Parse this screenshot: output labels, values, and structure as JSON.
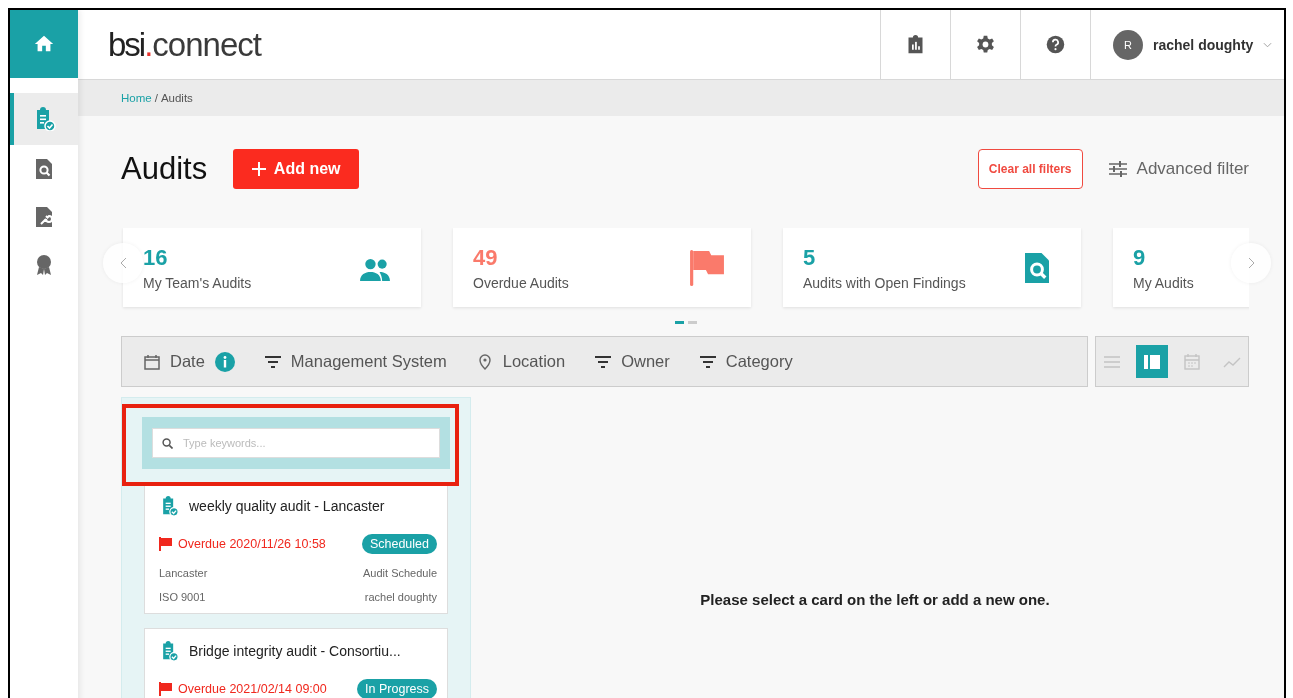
{
  "sidebar": {
    "items": [
      {
        "kind": "audits",
        "selected": true
      },
      {
        "kind": "findings",
        "selected": false
      },
      {
        "kind": "actions",
        "selected": false
      },
      {
        "kind": "certificates",
        "selected": false
      }
    ]
  },
  "header": {
    "logo": {
      "brand": "bsi",
      "dot": ".",
      "product": "connect"
    },
    "user": {
      "initial": "R",
      "name": "rachel doughty"
    }
  },
  "breadcrumb": {
    "link": "Home",
    "separator": "/",
    "current": "Audits"
  },
  "page": {
    "title": "Audits",
    "add_button": "Add new",
    "clear_filters": "Clear all filters",
    "advanced_filter": "Advanced filter"
  },
  "stats": [
    {
      "kind": "team",
      "value": "16",
      "label": "My Team's Audits",
      "color": "#1aa1a6"
    },
    {
      "kind": "overdue",
      "value": "49",
      "label": "Overdue Audits",
      "color": "#fa7a6b"
    },
    {
      "kind": "findings",
      "value": "5",
      "label": "Audits with Open Findings",
      "color": "#1aa1a6"
    },
    {
      "kind": "mine",
      "value": "9",
      "label": "My Audits",
      "color": "#1aa1a6"
    }
  ],
  "carousel_pages": [
    {
      "selected": true
    },
    {
      "selected": false
    }
  ],
  "filters": [
    {
      "kind": "date",
      "label": "Date"
    },
    {
      "kind": "filter",
      "label": "Management System"
    },
    {
      "kind": "location",
      "label": "Location"
    },
    {
      "kind": "filter",
      "label": "Owner"
    },
    {
      "kind": "filter",
      "label": "Category"
    }
  ],
  "views": [
    {
      "kind": "list",
      "selected": false
    },
    {
      "kind": "board",
      "selected": true
    },
    {
      "kind": "calendar",
      "selected": false
    },
    {
      "kind": "chart",
      "selected": false
    }
  ],
  "search": {
    "placeholder": "Type keywords..."
  },
  "highlight_search": true,
  "audits": [
    {
      "title": "weekly quality audit - Lancaster",
      "due": "Overdue 2020/11/26 10:58",
      "overdue": true,
      "status": "Scheduled",
      "location": "Lancaster",
      "type": "Audit Schedule",
      "standard": "ISO 9001",
      "owner": "rachel doughty"
    },
    {
      "title": "Bridge integrity audit - Consortiu...",
      "due": "Overdue 2021/02/14 09:00",
      "overdue": true,
      "status": "In Progress"
    }
  ],
  "empty_message": "Please select a card on the left or add a new one."
}
